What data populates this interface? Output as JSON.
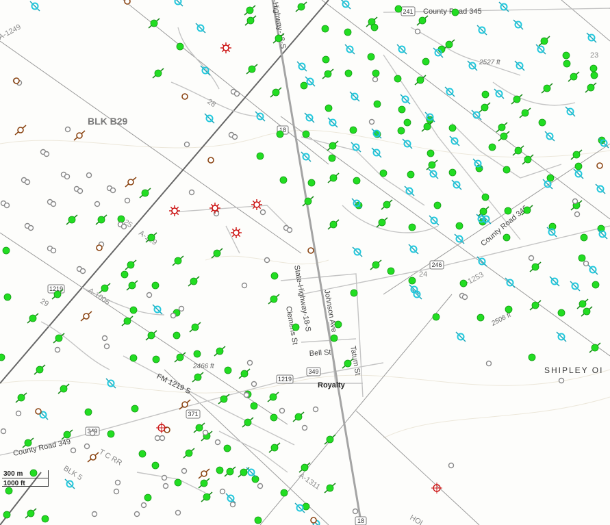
{
  "map": {
    "labels": {
      "block_b29": "BLK B29",
      "block_5": "BLK 5",
      "royalty": "Royalty",
      "shipley": "SHIPLEY OI",
      "hol": "HOL",
      "county_road_345": "County Road 345",
      "county_road_346": "County Road 346",
      "county_road_349": "County Road 349",
      "fm_1219": "FM 1219 S",
      "state_highway_18s": "State-Highway-18-S",
      "highway_18s_top": "-Highway-18-S",
      "clemens_st": "Clemens St",
      "johnson_ave": "Johnson Ave",
      "bell_st": "Bell St",
      "tatum_st": "Tatum St",
      "tcrr": "T C RR",
      "a1249": "A-1249",
      "a1253": "A-1253",
      "a1006": "A-1006",
      "a1311": "A-1311",
      "a129": "A-129",
      "num_23": "23",
      "num_24": "24",
      "num_28": "28",
      "num_29": "29",
      "num_25": "25",
      "elev_2527": "2527 ft",
      "elev_2466": "2466 ft",
      "elev_2506": "2506 ft"
    },
    "shields": {
      "s241": "241",
      "s18a": "18",
      "s18b": "18",
      "s1219a": "1219",
      "s1219b": "1219",
      "s246": "246",
      "s349a": "349",
      "s349b": "349",
      "s371": "371"
    },
    "scale": {
      "metric": "300 m",
      "imperial": "1000 ft"
    },
    "colors": {
      "oil_well": "#22dd22",
      "gas_well": "#22c8dd",
      "plugged_well": "#888888",
      "brown_well": "#8b4513",
      "permit": "#cc1111",
      "road": "#bdbdbd",
      "highway": "#9a9a9a",
      "boundary": "#666666"
    }
  }
}
